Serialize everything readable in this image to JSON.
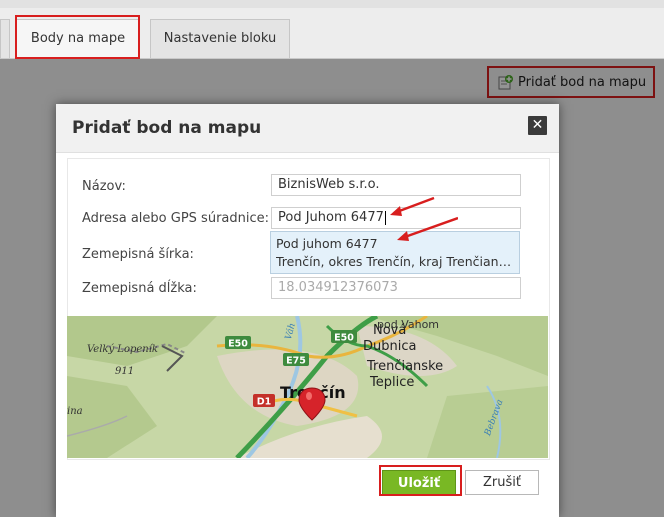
{
  "tabs": [
    {
      "label": "Body na mape",
      "active": true
    },
    {
      "label": "Nastavenie bloku",
      "active": false
    }
  ],
  "toolbar": {
    "add_point_label": "Pridať bod na mapu",
    "add_point_icon": "add-location-icon"
  },
  "modal": {
    "title": "Pridať bod na mapu",
    "close_icon": "close-icon",
    "fields": {
      "name_label": "Názov:",
      "name_value": "BiznisWeb s.r.o.",
      "address_label": "Adresa alebo GPS súradnice:",
      "address_value": "Pod Juhom 6477",
      "lat_label": "Zemepisná šírka:",
      "lng_label": "Zemepisná dĺžka:",
      "lng_value": "18.034912376073"
    },
    "suggestion": {
      "line1": "Pod juhom 6477",
      "line2": "Trenčín, okres Trenčín, kraj Trenčiansk…"
    },
    "map": {
      "labels": {
        "city": "Trenčín",
        "nova_1": "Nová",
        "nova_2": "Dubnica",
        "teplice_1": "Trenčianske",
        "teplice_2": "Teplice",
        "lopenik": "Velký Lopeník",
        "lopenik_alt": "911",
        "partial_top": "pod Vahom",
        "partial_left": "ina",
        "bebrava": "Bebrava",
        "river_top": "Váh"
      },
      "road_badges": [
        "E50",
        "E50",
        "E75",
        "D1"
      ]
    },
    "buttons": {
      "save": "Uložiť",
      "cancel": "Zrušiť"
    }
  },
  "colors": {
    "highlight_red": "#d81e1e",
    "save_green": "#79b824",
    "map_marker": "#d6232a"
  }
}
